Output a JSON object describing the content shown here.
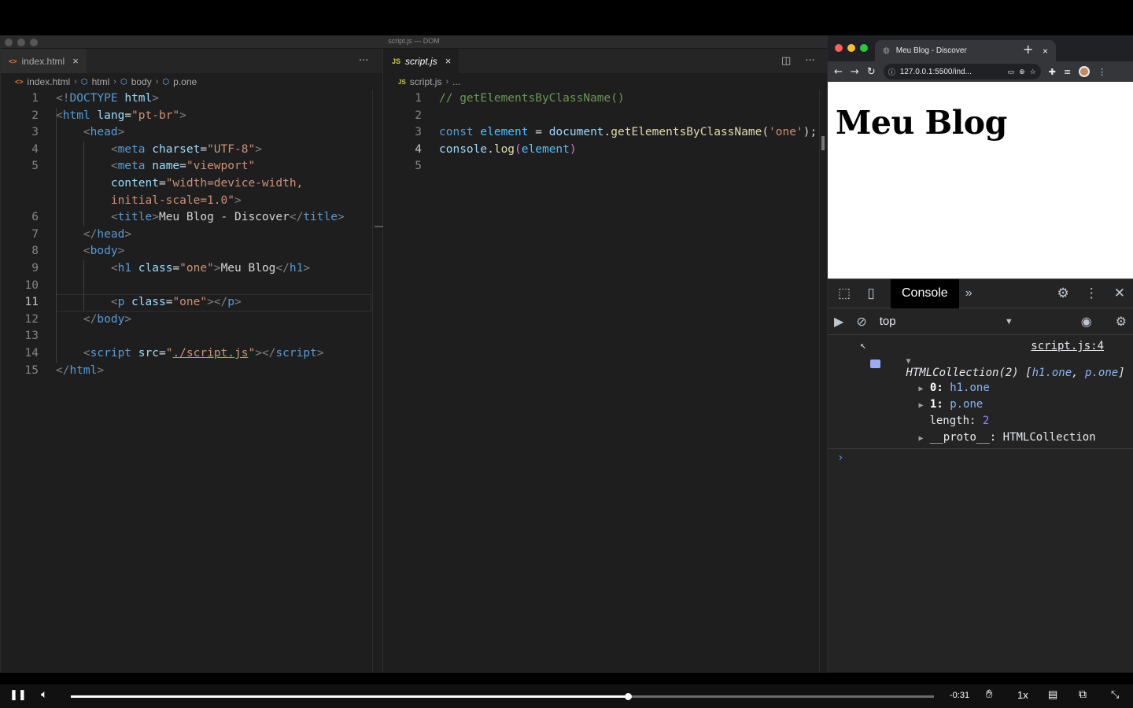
{
  "vscode": {
    "window_title": "script.js — DOM",
    "left": {
      "tab": {
        "icon": "<>",
        "label": "index.html",
        "close": "×"
      },
      "more": "···",
      "breadcrumb": [
        "index.html",
        "html",
        "body",
        "p.one"
      ]
    },
    "right": {
      "tab": {
        "icon": "JS",
        "label": "script.js",
        "close": "×"
      },
      "more": "···",
      "breadcrumb": [
        "script.js",
        "..."
      ]
    }
  },
  "browser": {
    "tab_title": "Meu Blog - Discover",
    "tab_close": "×",
    "new_tab": "+",
    "url": "127.0.0.1:5500/ind...",
    "page_heading": "Meu Blog"
  },
  "devtools": {
    "active_tab": "Console",
    "more_tabs": "»",
    "context": "top",
    "source_link": "script.js:4",
    "output": {
      "collection": "HTMLCollection(2) [",
      "item_a": "h1.one",
      "comma": ", ",
      "item_b": "p.one",
      "close": "]",
      "entry0_key": "0:",
      "entry0_val": "h1.one",
      "entry1_key": "1:",
      "entry1_val": "p.one",
      "length_key": "length:",
      "length_val": "2",
      "proto_key": "__proto__:",
      "proto_val": "HTMLCollection"
    },
    "prompt": "›"
  },
  "video": {
    "time_remaining": "-0:31",
    "speed": "1x",
    "progress": 0.645
  },
  "left_gutter": [
    "1",
    "2",
    "3",
    "4",
    "5",
    "",
    "",
    "6",
    "7",
    "8",
    "9",
    "10",
    "11",
    "12",
    "13",
    "14",
    "15"
  ],
  "right_gutter": [
    "1",
    "2",
    "3",
    "4",
    "5"
  ],
  "left_code": [
    [
      [
        "punct",
        "<!"
      ],
      [
        "tag",
        "DOCTYPE"
      ],
      [
        "text",
        " "
      ],
      [
        "attr",
        "html"
      ],
      [
        "punct",
        ">"
      ]
    ],
    [
      [
        "punct",
        "<"
      ],
      [
        "tag",
        "html"
      ],
      [
        "text",
        " "
      ],
      [
        "attr",
        "lang"
      ],
      [
        "text",
        "="
      ],
      [
        "str",
        "\"pt-br\""
      ],
      [
        "punct",
        ">"
      ]
    ],
    [
      [
        "text",
        "    "
      ],
      [
        "punct",
        "<"
      ],
      [
        "tag",
        "head"
      ],
      [
        "punct",
        ">"
      ]
    ],
    [
      [
        "text",
        "        "
      ],
      [
        "punct",
        "<"
      ],
      [
        "tag",
        "meta"
      ],
      [
        "text",
        " "
      ],
      [
        "attr",
        "charset"
      ],
      [
        "text",
        "="
      ],
      [
        "str",
        "\"UTF-8\""
      ],
      [
        "punct",
        ">"
      ]
    ],
    [
      [
        "text",
        "        "
      ],
      [
        "punct",
        "<"
      ],
      [
        "tag",
        "meta"
      ],
      [
        "text",
        " "
      ],
      [
        "attr",
        "name"
      ],
      [
        "text",
        "="
      ],
      [
        "str",
        "\"viewport\""
      ]
    ],
    [
      [
        "text",
        "        "
      ],
      [
        "attr",
        "content"
      ],
      [
        "text",
        "="
      ],
      [
        "str",
        "\"width=device-width,"
      ]
    ],
    [
      [
        "text",
        "        "
      ],
      [
        "str",
        "initial-scale=1.0\""
      ],
      [
        "punct",
        ">"
      ]
    ],
    [
      [
        "text",
        "        "
      ],
      [
        "punct",
        "<"
      ],
      [
        "tag",
        "title"
      ],
      [
        "punct",
        ">"
      ],
      [
        "text",
        "Meu Blog - Discover"
      ],
      [
        "punct",
        "</"
      ],
      [
        "tag",
        "title"
      ],
      [
        "punct",
        ">"
      ]
    ],
    [
      [
        "text",
        "    "
      ],
      [
        "punct",
        "</"
      ],
      [
        "tag",
        "head"
      ],
      [
        "punct",
        ">"
      ]
    ],
    [
      [
        "text",
        "    "
      ],
      [
        "punct",
        "<"
      ],
      [
        "tag",
        "body"
      ],
      [
        "punct",
        ">"
      ]
    ],
    [
      [
        "text",
        "        "
      ],
      [
        "punct",
        "<"
      ],
      [
        "tag",
        "h1"
      ],
      [
        "text",
        " "
      ],
      [
        "attr",
        "class"
      ],
      [
        "text",
        "="
      ],
      [
        "str",
        "\"one\""
      ],
      [
        "punct",
        ">"
      ],
      [
        "text",
        "Meu Blog"
      ],
      [
        "punct",
        "</"
      ],
      [
        "tag",
        "h1"
      ],
      [
        "punct",
        ">"
      ]
    ],
    [],
    [
      [
        "text",
        "        "
      ],
      [
        "punct",
        "<"
      ],
      [
        "tag",
        "p"
      ],
      [
        "text",
        " "
      ],
      [
        "attr",
        "class"
      ],
      [
        "text",
        "="
      ],
      [
        "str",
        "\"one\""
      ],
      [
        "punct",
        ">"
      ],
      [
        "punct",
        "</"
      ],
      [
        "tag",
        "p"
      ],
      [
        "punct",
        ">"
      ]
    ],
    [
      [
        "text",
        "    "
      ],
      [
        "punct",
        "</"
      ],
      [
        "tag",
        "body"
      ],
      [
        "punct",
        ">"
      ]
    ],
    [],
    [
      [
        "text",
        "    "
      ],
      [
        "punct",
        "<"
      ],
      [
        "tag",
        "script"
      ],
      [
        "text",
        " "
      ],
      [
        "attr",
        "src"
      ],
      [
        "text",
        "="
      ],
      [
        "str",
        "\""
      ],
      [
        "link",
        "./script.js"
      ],
      [
        "str",
        "\""
      ],
      [
        "punct",
        "></"
      ],
      [
        "tag",
        "script"
      ],
      [
        "punct",
        ">"
      ]
    ],
    [
      [
        "punct",
        "</"
      ],
      [
        "tag",
        "html"
      ],
      [
        "punct",
        ">"
      ]
    ]
  ],
  "right_code": [
    [
      [
        "comment",
        "// getElementsByClassName()"
      ]
    ],
    [],
    [
      [
        "kw",
        "const"
      ],
      [
        "text",
        " "
      ],
      [
        "var",
        "element"
      ],
      [
        "text",
        " = "
      ],
      [
        "prop",
        "document"
      ],
      [
        "text",
        "."
      ],
      [
        "fn",
        "getElementsByClassName"
      ],
      [
        "text",
        "("
      ],
      [
        "str",
        "'one'"
      ],
      [
        "text",
        ");"
      ]
    ],
    [
      [
        "prop",
        "console"
      ],
      [
        "text",
        "."
      ],
      [
        "fn",
        "log"
      ],
      [
        "paren",
        "("
      ],
      [
        "var",
        "element"
      ],
      [
        "paren",
        ")"
      ]
    ],
    []
  ]
}
